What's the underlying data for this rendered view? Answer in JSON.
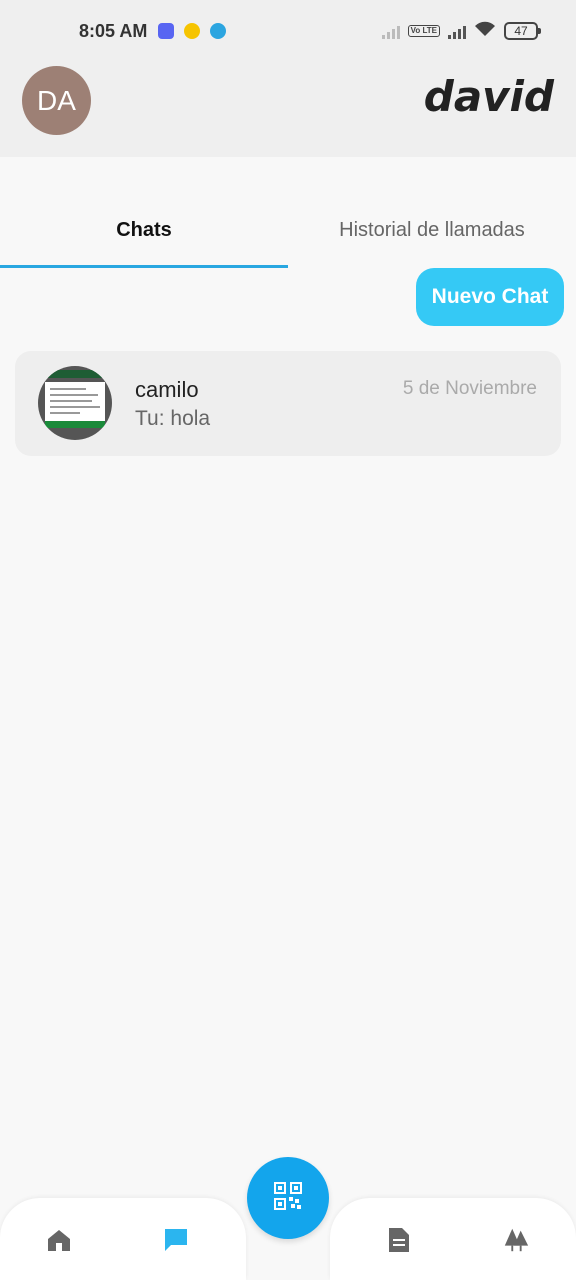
{
  "status_bar": {
    "time": "8:05 AM",
    "battery": "47",
    "volte": "Vo LTE"
  },
  "header": {
    "avatar_initials": "DA",
    "username": "david"
  },
  "tabs": [
    {
      "label": "Chats",
      "active": true
    },
    {
      "label": "Historial de llamadas",
      "active": false
    }
  ],
  "new_chat_label": "Nuevo Chat",
  "chats": [
    {
      "name": "camilo",
      "preview": "Tu: hola",
      "date": "5 de Noviembre"
    }
  ],
  "bottom_nav": {
    "items": [
      "home-icon",
      "chat-icon",
      "qr-code-icon",
      "document-icon",
      "trees-icon"
    ],
    "active": "chat-icon"
  },
  "colors": {
    "accent": "#29a7e1",
    "new_chat_button": "#35c9f5",
    "fab": "#13a5ec",
    "avatar": "#9d8075"
  }
}
